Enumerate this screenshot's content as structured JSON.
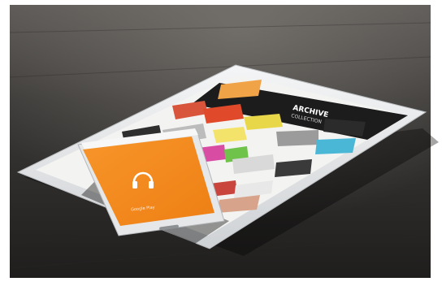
{
  "tablet": {
    "banner_title": "ARCHIVE",
    "banner_subtitle": "COLLECTION"
  },
  "phone": {
    "app_icon": "headphones-icon",
    "app_label": "Google Play"
  },
  "colors": {
    "table": "#3a3836",
    "device_frame": "#e8eaec",
    "phone_screen": "#f28a1e",
    "headphones": "#ffffff"
  }
}
